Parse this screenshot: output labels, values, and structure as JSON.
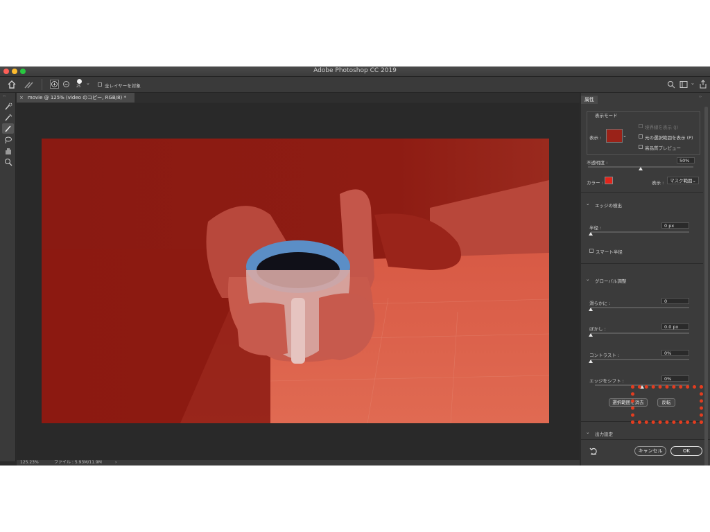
{
  "window": {
    "title": "Adobe Photoshop CC 2019"
  },
  "options_bar": {
    "brush_size": "25",
    "sample_all_layers": "全レイヤーを対象"
  },
  "document_tab": {
    "label": "movie @ 125% (video のコピー, RGB/8) *"
  },
  "status_bar": {
    "zoom": "125.23%",
    "file_size": "ファイル : 5.93M/11.9M"
  },
  "properties": {
    "tab_label": "属性",
    "view_mode": {
      "section_title": "表示モード",
      "view_label": "表示 :",
      "show_edge": "境界線を表示 (J)",
      "show_original": "元の選択範囲を表示 (P)",
      "high_quality": "高品質プレビュー"
    },
    "opacity": {
      "label": "不透明度 :",
      "value": "50%",
      "fraction": 0.5
    },
    "color": {
      "label": "カラー :",
      "swatch": "#e0241b",
      "display_label": "表示 :",
      "display_value": "マスク範囲"
    },
    "edge_detection": {
      "title": "エッジの検出",
      "radius_label": "半径 :",
      "radius_value": "0 px",
      "radius_fraction": 0,
      "smart_radius": "スマート半径"
    },
    "global_refinements": {
      "title": "グローバル調整",
      "smooth_label": "滑らかに :",
      "smooth_value": "0",
      "smooth_fraction": 0,
      "feather_label": "ぼかし :",
      "feather_value": "0.0 px",
      "feather_fraction": 0,
      "contrast_label": "コントラスト :",
      "contrast_value": "0%",
      "contrast_fraction": 0,
      "shift_edge_label": "エッジをシフト :",
      "shift_edge_value": "0%",
      "shift_edge_fraction": 0.5
    },
    "buttons": {
      "clear_selection": "選択範囲を消去",
      "invert": "反転"
    },
    "output_settings": {
      "title": "出力設定"
    },
    "footer": {
      "cancel": "キャンセル",
      "ok": "OK"
    }
  },
  "colors": {
    "highlight": "#e23d20",
    "mask_overlay": "#8c1a12"
  }
}
